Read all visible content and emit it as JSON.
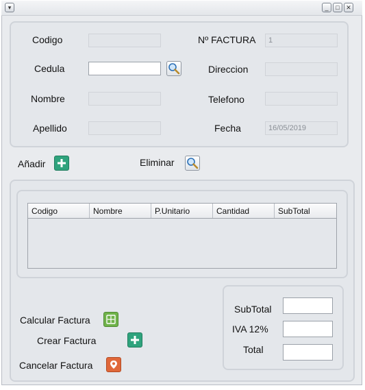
{
  "window": {
    "menu_icon": "dropdown-arrow-icon",
    "controls": [
      "minimize-icon",
      "maximize-icon",
      "close-icon"
    ]
  },
  "client": {
    "codigo_label": "Codigo",
    "cedula_label": "Cedula",
    "nombre_label": "Nombre",
    "apellido_label": "Apellido",
    "codigo_value": "",
    "cedula_value": "",
    "nombre_value": "",
    "apellido_value": "",
    "search_icon": "magnifier-icon"
  },
  "invoice": {
    "factura_label": "Nº FACTURA",
    "factura_value": "1",
    "direccion_label": "Direccion",
    "telefono_label": "Telefono",
    "fecha_label": "Fecha",
    "direccion_value": "",
    "telefono_value": "",
    "fecha_value": "16/05/2019"
  },
  "items_actions": {
    "add_label": "Añadir",
    "remove_label": "Eliminar",
    "add_icon": "plus-icon",
    "remove_icon": "magnifier-icon"
  },
  "table": {
    "columns": [
      "Codigo",
      "Nombre",
      "P.Unitario",
      "Cantidad",
      "SubTotal"
    ],
    "rows": []
  },
  "actions": {
    "calculate_label": "Calcular Factura",
    "create_label": "Crear Factura",
    "cancel_label": "Cancelar Factura"
  },
  "totals": {
    "subtotal_label": "SubTotal",
    "iva_label": "IVA 12%",
    "total_label": "Total",
    "subtotal_value": "",
    "iva_value": "",
    "total_value": ""
  },
  "colors": {
    "panel_bg": "#e4e7eb",
    "frame_bg": "#e9ebee",
    "green_icon": "#2fa37d",
    "orange_icon": "#e0683a"
  }
}
